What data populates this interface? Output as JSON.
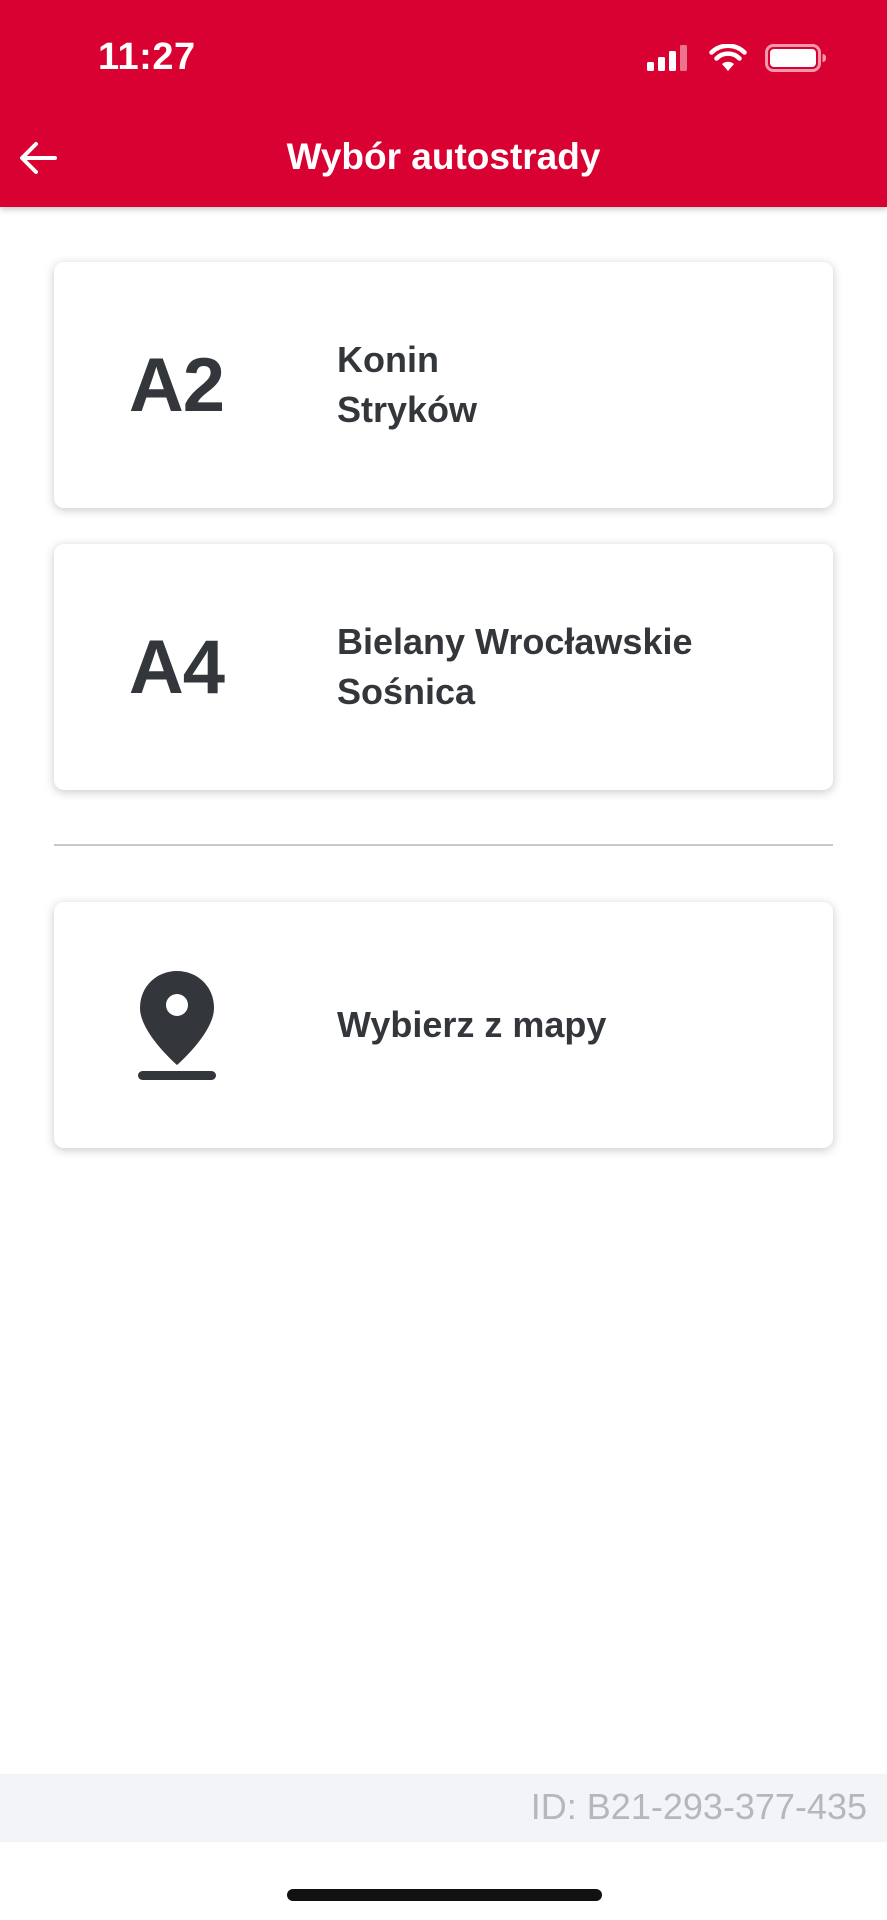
{
  "status_bar": {
    "time": "11:27",
    "icons": [
      "signal-icon",
      "wifi-icon",
      "battery-icon"
    ]
  },
  "header": {
    "title": "Wybór autostrady",
    "back_icon": "arrow-left-icon",
    "background_color": "#d90032"
  },
  "highways": [
    {
      "code": "A2",
      "line1": "Konin",
      "line2": "Stryków"
    },
    {
      "code": "A4",
      "line1": "Bielany Wrocławskie",
      "line2": "Sośnica"
    }
  ],
  "map_option": {
    "icon": "map-pin-icon",
    "label": "Wybierz z mapy"
  },
  "footer": {
    "id_text": "ID: B21-293-377-435"
  }
}
